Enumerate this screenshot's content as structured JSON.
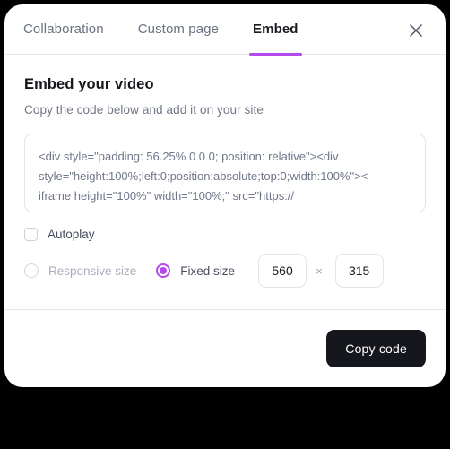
{
  "colors": {
    "accent": "#b44aee",
    "page_background": "#000000",
    "card_background": "#ffffff",
    "button_dark": "#16171c",
    "muted_text": "#707786"
  },
  "tabs": [
    {
      "label": "Collaboration",
      "active": false
    },
    {
      "label": "Custom page",
      "active": false
    },
    {
      "label": "Embed",
      "active": true
    }
  ],
  "close_icon": "close-icon",
  "content": {
    "title": "Embed your video",
    "subtitle": "Copy the code below and add it on your site",
    "code_lines": [
      "<div style=\"padding: 56.25% 0 0 0; position: relative\"><div",
      "style=\"height:100%;left:0;position:absolute;top:0;width:100%\"><",
      "iframe height=\"100%\" width=\"100%;\" src=\"https://"
    ]
  },
  "options": {
    "autoplay": {
      "label": "Autoplay",
      "checked": false
    },
    "responsive_size": {
      "label": "Responsive size",
      "selected": false
    },
    "fixed_size": {
      "label": "Fixed size",
      "selected": true
    },
    "width_value": "560",
    "separator": "×",
    "height_value": "315"
  },
  "footer": {
    "copy_label": "Copy code"
  }
}
